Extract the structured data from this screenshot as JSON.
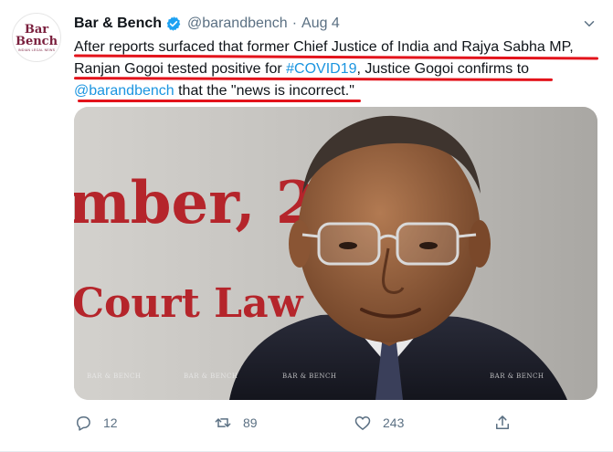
{
  "tweet": {
    "author_name": "Bar & Bench",
    "handle": "@barandbench",
    "separator": "·",
    "date": "Aug 4",
    "avatar": {
      "line1": "Bar",
      "line2": "Bench",
      "line3": "INDIAN LEGAL NEWS"
    },
    "text_part1": "After reports surfaced that former Chief Justice of India and Rajya Sabha MP, Ranjan Gogoi tested positive for ",
    "hashtag": "#COVID19",
    "text_part2": ", Justice Gogoi confirms to ",
    "mention": "@barandbench",
    "text_part3": " that the \"news is incorrect.\""
  },
  "photo": {
    "bg_text_line1": "mber, 2",
    "bg_text_line2": "Court Law",
    "watermark": "BAR & BENCH"
  },
  "actions": {
    "reply_count": "12",
    "retweet_count": "89",
    "like_count": "243"
  },
  "colors": {
    "link": "#1b95e0",
    "muted": "#5b7083",
    "highlight_underline": "#e3131b",
    "verified": "#1da1f2"
  }
}
